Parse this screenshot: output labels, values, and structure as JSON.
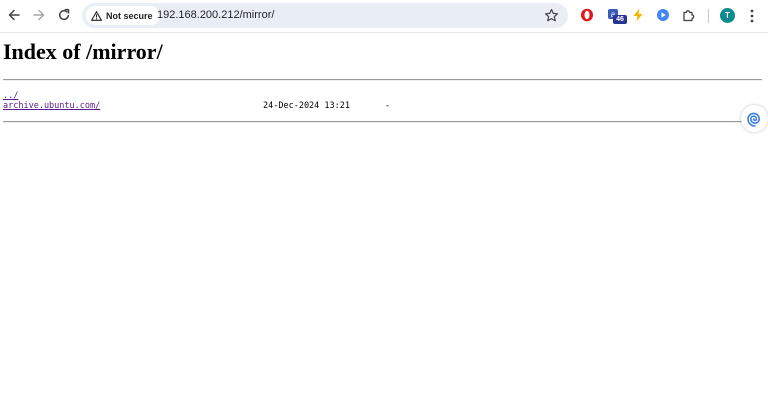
{
  "browser": {
    "security_label": "Not secure",
    "url": "192.168.200.212/mirror/",
    "extension_badge": "46",
    "profile_initial": "T"
  },
  "page": {
    "title": "Index of /mirror/",
    "entries": [
      {
        "name": "../",
        "date": "",
        "size": ""
      },
      {
        "name": "archive.ubuntu.com/",
        "date": "24-Dec-2024 13:21",
        "size": "-"
      }
    ]
  },
  "colors": {
    "link_visited": "#551a8b",
    "omnibox_bg": "#e9eef6",
    "avatar_bg": "#0b8a8f"
  }
}
